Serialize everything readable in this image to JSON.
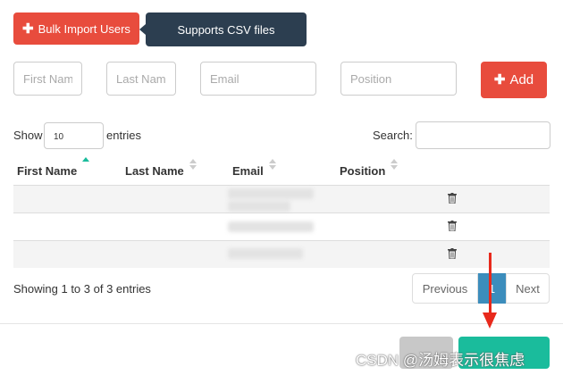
{
  "toolbar": {
    "import_label": "Bulk Import Users",
    "tooltip": "Supports CSV files"
  },
  "form": {
    "first_name_placeholder": "First Nam",
    "last_name_placeholder": "Last Name",
    "email_placeholder": "Email",
    "position_placeholder": "Position",
    "add_label": "Add"
  },
  "table_controls": {
    "show_label": "Show",
    "page_length": "10",
    "entries_label": "entries",
    "search_label": "Search:"
  },
  "table": {
    "columns": [
      "First Name",
      "Last Name",
      "Email",
      "Position"
    ],
    "sorted_column": "First Name",
    "rows": [
      {
        "first_name": "",
        "last_name": "",
        "email": "",
        "position": ""
      },
      {
        "first_name": "",
        "last_name": "",
        "email": "",
        "position": ""
      },
      {
        "first_name": "",
        "last_name": "",
        "email": "",
        "position": ""
      }
    ]
  },
  "pagination": {
    "info": "Showing 1 to 3 of 3 entries",
    "previous": "Previous",
    "current": "1",
    "next": "Next"
  },
  "watermark": "CSDN @汤姆表示很焦虑",
  "colors": {
    "danger": "#e84c3d",
    "tooltip_bg": "#2c3e50",
    "primary": "#3c8dbc",
    "success": "#1abc9c",
    "annotation_arrow": "#e8291c"
  },
  "icons": {
    "add": "plus-icon",
    "delete": "trash-icon",
    "sort": "sort-icon"
  }
}
